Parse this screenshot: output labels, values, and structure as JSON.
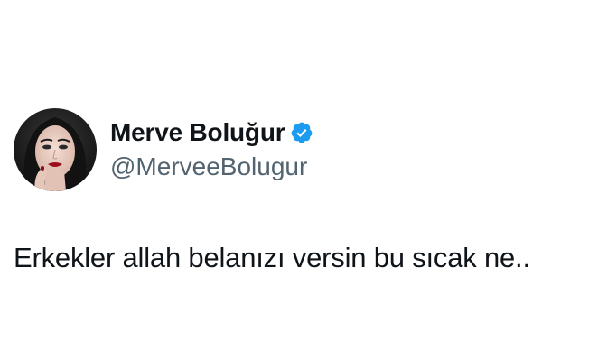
{
  "author": {
    "display_name": "Merve Boluğur",
    "handle": "@MerveeBolugur",
    "verified": true,
    "verified_color": "#1d9bf0",
    "avatar": "profile-photo"
  },
  "tweet": {
    "text": "Erkekler allah belanızı versin bu sıcak ne.."
  },
  "colors": {
    "background": "#ffffff",
    "text_primary": "#0f1419",
    "text_secondary": "#536471"
  }
}
